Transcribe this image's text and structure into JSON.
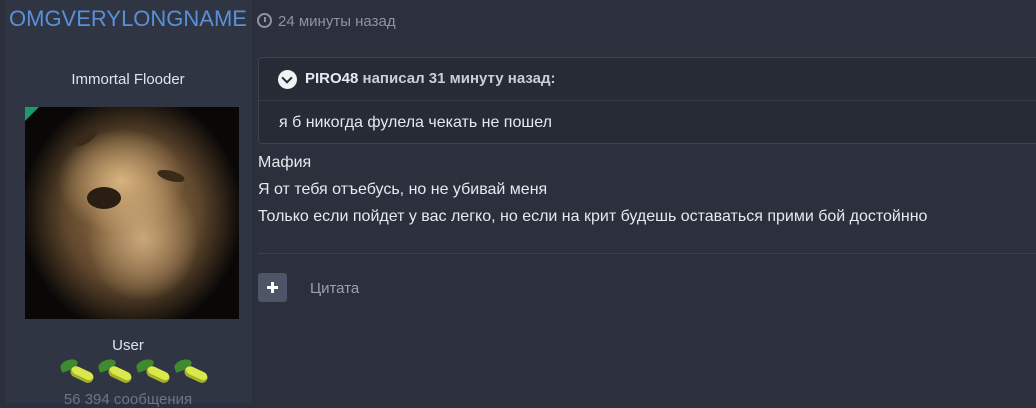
{
  "author": {
    "name": "OMGVERYLONGNAME",
    "title": "Immortal Flooder",
    "group": "User",
    "post_count": "56 394 сообщения",
    "rank_icons": [
      "pill-icon",
      "pill-icon",
      "pill-icon",
      "pill-icon"
    ]
  },
  "post": {
    "time": "24 минуты назад",
    "quote": {
      "author": "PIRO48",
      "suffix": "написал 31 минуту назад:",
      "text": "я б никогда фулела чекать не пошел"
    },
    "lines": [
      "Мафия",
      "Я от тебя отъебусь, но не убивай меня",
      "Только если пойдет у вас легко, но если на крит будешь оставаться прими бой достойнно"
    ],
    "actions": {
      "quote_label": "Цитата"
    }
  },
  "colors": {
    "author_link": "#5b8fd8",
    "background": "#2b303c",
    "online": "#1c9a6c"
  }
}
